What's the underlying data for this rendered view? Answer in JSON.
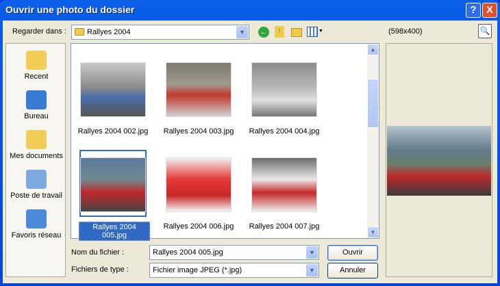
{
  "window": {
    "title": "Ouvrir une photo du dossier",
    "help": "?",
    "close": "X"
  },
  "toolbar": {
    "look_in_label": "Regarder dans :",
    "look_in_value": "Rallyes 2004",
    "preview_size": "(598x400)"
  },
  "places": [
    {
      "label": "Recent",
      "icon": "recent-icon",
      "color": "#f3cd59"
    },
    {
      "label": "Bureau",
      "icon": "desktop-icon",
      "color": "#3a7bd5"
    },
    {
      "label": "Mes documents",
      "icon": "my-documents-icon",
      "color": "#f3cd59"
    },
    {
      "label": "Poste de travail",
      "icon": "my-computer-icon",
      "color": "#7ea9de"
    },
    {
      "label": "Favoris réseau",
      "icon": "network-icon",
      "color": "#4b8ad6"
    }
  ],
  "files": [
    {
      "name": "Rallyes 2004 002.jpg",
      "bg": "linear-gradient(#c9c9c9 0%,#8c8c8c 45%,#4a6ea8 65%,#555 100%)"
    },
    {
      "name": "Rallyes 2004 003.jpg",
      "bg": "linear-gradient(#7d7a70 0%,#a19b90 40%,#c0392b 60%,#d0d0d0 100%)"
    },
    {
      "name": "Rallyes 2004 004.jpg",
      "bg": "linear-gradient(#8c8c8c 0%,#bdbdbd 50%,#e0e0e0 70%,#777 100%)"
    },
    {
      "name": "Rallyes 2004 005.jpg",
      "bg": "linear-gradient(#5a7a9a 0%,#6f8a8f 40%,#c0282a 65%,#444 100%)",
      "selected": true
    },
    {
      "name": "Rallyes 2004 006.jpg",
      "bg": "linear-gradient(#f0f0f0 0%,#e53935 40%,#c62828 70%,#f5f5f5 100%)"
    },
    {
      "name": "Rallyes 2004 007.jpg",
      "bg": "linear-gradient(#6d6d6d 0%,#e8e8e8 40%,#c62828 65%,#eeeeee 100%)"
    }
  ],
  "bottom": {
    "filename_label": "Nom du fichier :",
    "filename_value": "Rallyes 2004 005.jpg",
    "filetype_label": "Fichiers de type :",
    "filetype_value": "Fichier image JPEG (*.jpg)",
    "open": "Ouvrir",
    "cancel": "Annuler"
  }
}
